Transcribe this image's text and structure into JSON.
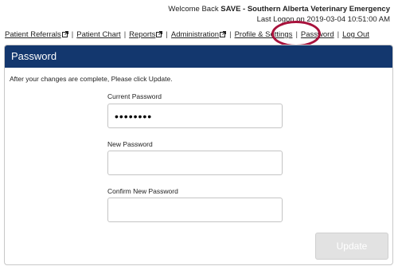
{
  "header": {
    "welcome_prefix": "Welcome Back",
    "user": "SAVE - Southern Alberta Veterinary Emergency",
    "last_logon": "Last Logon on 2019-03-04 10:51:00 AM"
  },
  "nav": {
    "items": [
      {
        "label": "Patient Referrals",
        "external": true
      },
      {
        "label": "Patient Chart",
        "external": false
      },
      {
        "label": "Reports",
        "external": true
      },
      {
        "label": "Administration",
        "external": true
      },
      {
        "label": "Profile & Settings",
        "external": false
      },
      {
        "label": "Password",
        "external": false
      },
      {
        "label": "Log Out",
        "external": false
      }
    ]
  },
  "panel": {
    "title": "Password",
    "instructions": "After your changes are complete, Please click Update.",
    "current_password_label": "Current Password",
    "current_password_value": "••••••••",
    "new_password_label": "New Password",
    "new_password_value": "",
    "confirm_password_label": "Confirm New Password",
    "confirm_password_value": "",
    "update_label": "Update"
  },
  "colors": {
    "header_bar": "#13376e",
    "highlight": "#a8123c",
    "button_disabled": "#e2e2e2"
  },
  "icons": {
    "external": "external-link-icon"
  }
}
